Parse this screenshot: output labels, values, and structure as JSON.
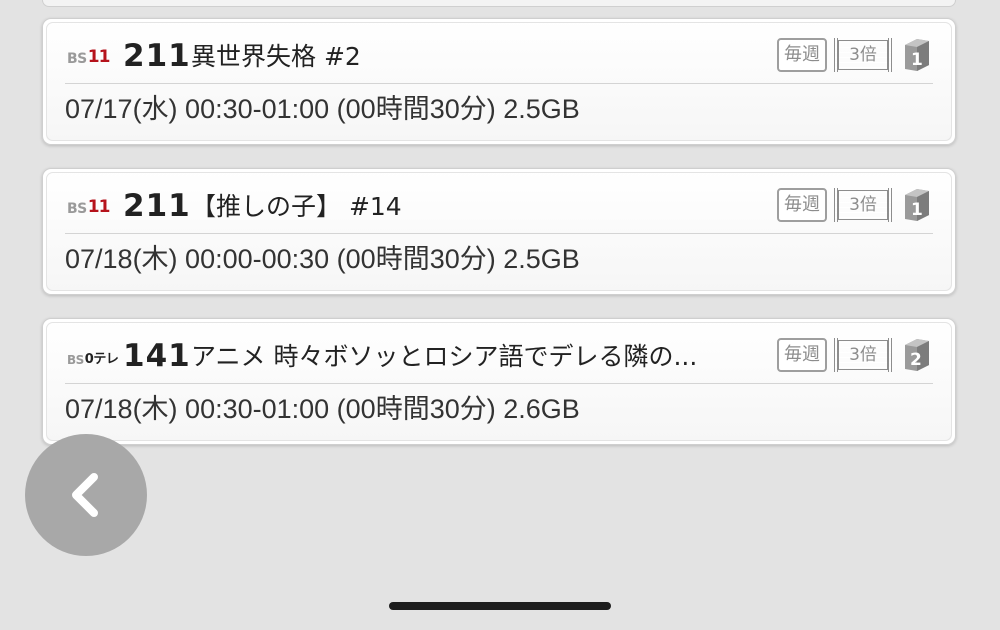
{
  "recordings": [
    {
      "station_logo": {
        "prefix": "BS",
        "mark": "11",
        "style": "bs11"
      },
      "channel": "211",
      "title": "異世界失格 #2",
      "detail": "07/17(水) 00:30-01:00 (00時間30分) 2.5GB",
      "badges": {
        "weekly": "毎週",
        "speed": "3倍",
        "disk": "1"
      }
    },
    {
      "station_logo": {
        "prefix": "BS",
        "mark": "11",
        "style": "bs11"
      },
      "channel": "211",
      "title": "【推しの子】 #14",
      "detail": "07/18(木) 00:00-00:30 (00時間30分) 2.5GB",
      "badges": {
        "weekly": "毎週",
        "speed": "3倍",
        "disk": "1"
      }
    },
    {
      "station_logo": {
        "prefix": "BS",
        "mark": "0テレ",
        "style": "ntv"
      },
      "channel": "141",
      "title": "アニメ 時々ボソッとロシア語でデレる隣の...",
      "detail": "07/18(木) 00:30-01:00 (00時間30分) 2.6GB",
      "badges": {
        "weekly": "毎週",
        "speed": "3倍",
        "disk": "2"
      }
    }
  ],
  "colors": {
    "background": "#e3e3e3",
    "bs11_red": "#b5121b",
    "badge_gray": "#8d8d8d",
    "back_button": "#a8a8a8"
  },
  "icons": {
    "back": "chevron-left-icon",
    "disk": "disk-number-icon"
  }
}
